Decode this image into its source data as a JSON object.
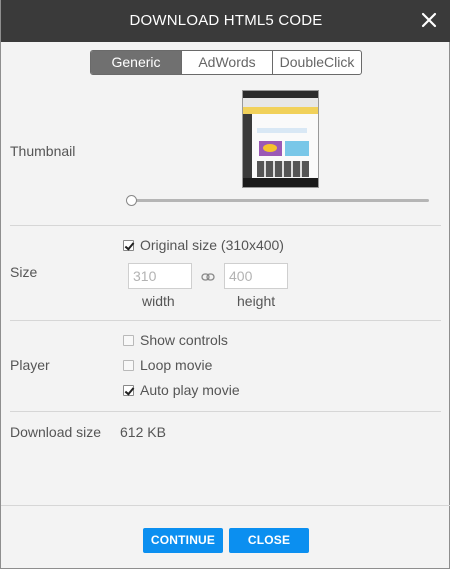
{
  "dialog": {
    "title": "DOWNLOAD HTML5 CODE",
    "close_icon": "close-icon"
  },
  "tabs": [
    {
      "label": "Generic",
      "active": true
    },
    {
      "label": "AdWords",
      "active": false
    },
    {
      "label": "DoubleClick",
      "active": false
    }
  ],
  "thumbnail": {
    "label": "Thumbnail",
    "slider_level": 0
  },
  "size": {
    "label": "Size",
    "original_size_label": "Original size (310x400)",
    "original_size_checked": true,
    "width_value": "310",
    "height_value": "400",
    "width_label": "width",
    "height_label": "height",
    "link_icon": "link-icon"
  },
  "player": {
    "label": "Player",
    "options": [
      {
        "label": "Show controls",
        "checked": false
      },
      {
        "label": "Loop movie",
        "checked": false
      },
      {
        "label": "Auto play movie",
        "checked": true
      }
    ]
  },
  "download": {
    "label": "Download size",
    "value": "612 KB"
  },
  "footer": {
    "continue_label": "CONTINUE",
    "close_label": "CLOSE"
  },
  "colors": {
    "titlebar": "#3a3a3a",
    "accent": "#0b8ff0",
    "active_tab": "#707070"
  }
}
